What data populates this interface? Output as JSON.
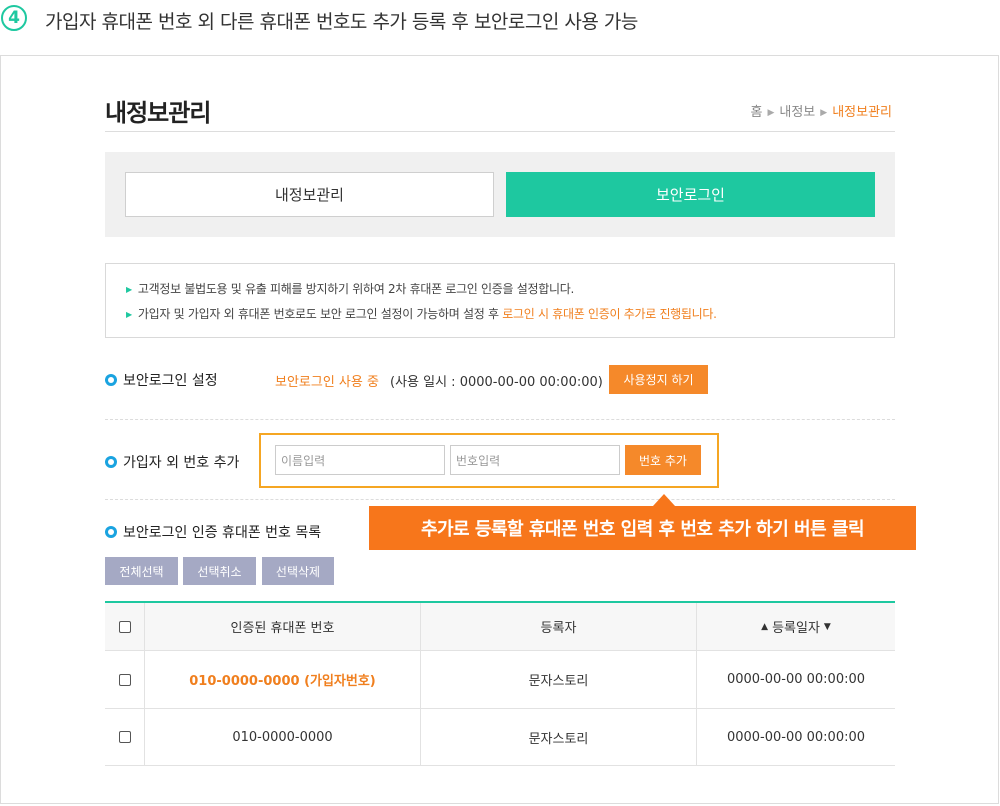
{
  "step": {
    "number": "4",
    "title": "가입자 휴대폰 번호 외 다른 휴대폰 번호도 추가 등록 후 보안로그인 사용 가능"
  },
  "page": {
    "title": "내정보관리",
    "breadcrumb": [
      "홈",
      "내정보",
      "내정보관리"
    ]
  },
  "tabs": [
    {
      "label": "내정보관리",
      "active": false
    },
    {
      "label": "보안로그인",
      "active": true
    }
  ],
  "notice": {
    "line1": "고객정보 불법도용 및 유출 피해를 방지하기 위하여 2차 휴대폰 로그인 인증을 설정합니다.",
    "line2_prefix": "가입자 및 가입자 외 휴대폰 번호로도 보안 로그인 설정이 가능하며 설정 후 ",
    "line2_highlight": "로그인 시 휴대폰 인증이 추가로 진행됩니다."
  },
  "security_login": {
    "label": "보안로그인 설정",
    "status": "보안로그인 사용 중",
    "usage": "(사용 일시 : 0000-00-00 00:00:00)",
    "stop_button": "사용정지 하기"
  },
  "add_number": {
    "label": "가입자 외 번호 추가",
    "name_placeholder": "이름입력",
    "number_placeholder": "번호입력",
    "add_button": "번호 추가"
  },
  "callout": {
    "text": "추가로 등록할 휴대폰 번호 입력 후 번호 추가 하기 버튼 클릭"
  },
  "list": {
    "label": "보안로그인 인증 휴대폰 번호 목록",
    "buttons": [
      "전체선택",
      "선택취소",
      "선택삭제"
    ],
    "columns": [
      "인증된 휴대폰 번호",
      "등록자",
      "등록일자"
    ],
    "sort_icons": [
      "▲",
      "▼"
    ],
    "rows": [
      {
        "phone": "010-0000-0000 (가입자번호)",
        "registrant": "문자스토리",
        "date": "0000-00-00 00:00:00",
        "primary": true
      },
      {
        "phone": "010-0000-0000",
        "registrant": "문자스토리",
        "date": "0000-00-00 00:00:00",
        "primary": false
      }
    ]
  },
  "colors": {
    "accent_green": "#1ec8a0",
    "accent_orange": "#f07f1e",
    "button_gray": "#a5a9c4",
    "bullet_blue": "#1aa3e0"
  }
}
